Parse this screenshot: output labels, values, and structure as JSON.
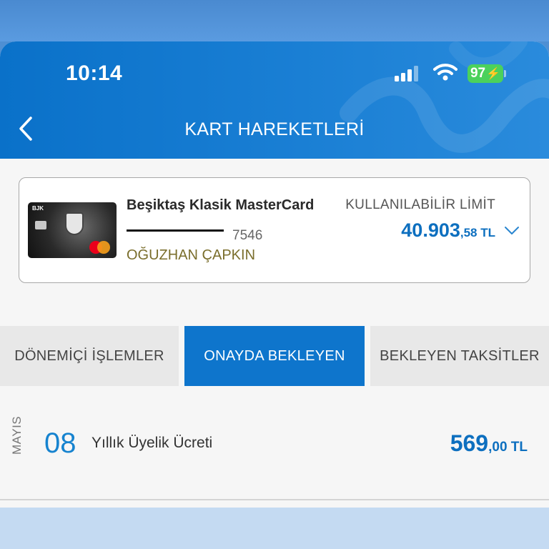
{
  "status_bar": {
    "time": "10:14",
    "battery_level": "97",
    "signal_icon": "cellular-signal-icon",
    "wifi_icon": "wifi-icon"
  },
  "nav": {
    "title": "KART HAREKETLERİ",
    "back_icon": "chevron-left-icon"
  },
  "card": {
    "name": "Beşiktaş Klasik MasterCard",
    "last4": "7546",
    "holder": "OĞUZHAN ÇAPKIN",
    "limit_label": "KULLANILABİLİR LİMİT",
    "limit_main": "40.903",
    "limit_decimal": ",58 TL",
    "image_brand": "BJK",
    "expand_icon": "chevron-down-icon"
  },
  "tabs": [
    {
      "label": "DÖNEMİÇİ İŞLEMLER",
      "active": false
    },
    {
      "label": "ONAYDA BEKLEYEN",
      "active": true
    },
    {
      "label": "BEKLEYEN TAKSİTLER",
      "active": false
    }
  ],
  "transactions": [
    {
      "month": "MAYIS",
      "day": "08",
      "description": "Yıllık Üyelik Ücreti",
      "amount_main": "569",
      "amount_decimal": ",00 TL"
    }
  ],
  "colors": {
    "header_blue": "#0a71c9",
    "active_tab": "#0e75cc",
    "amount_blue": "#0d6fbf",
    "holder_olive": "#7a6e2c",
    "battery_green": "#4bd15c"
  }
}
